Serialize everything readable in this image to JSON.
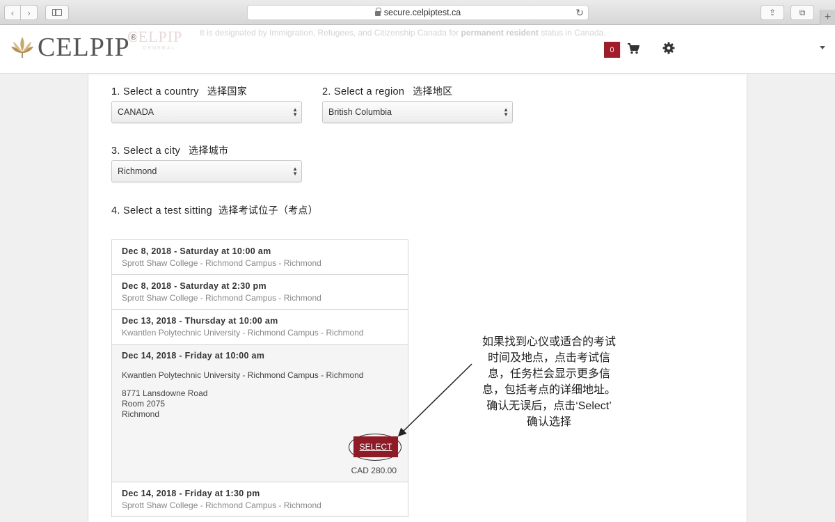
{
  "browser": {
    "url": "secure.celpiptest.ca",
    "back_glyph": "‹",
    "forward_glyph": "›",
    "reload_glyph": "↻",
    "share_glyph": "⇪",
    "tabs_glyph": "⧉",
    "newtab_glyph": "+"
  },
  "header": {
    "logo_text": "CELPIP",
    "logo_reg": "®",
    "ghost_logo": "CELPIP",
    "ghost_sub": "GENERAL",
    "ghost_banner_prefix": "It is designated by Immigration, Refugees, and Citizenship Canada for ",
    "ghost_banner_bold": "permanent resident",
    "ghost_banner_suffix": " status in Canada.",
    "cart_count": "0",
    "accent_color": "#a01c2a"
  },
  "form": {
    "country": {
      "label": "1. Select a country",
      "label_cn": "选择国家",
      "value": "CANADA"
    },
    "region": {
      "label": "2. Select a region",
      "label_cn": "选择地区",
      "value": "British Columbia"
    },
    "city": {
      "label": "3. Select a city",
      "label_cn": "选择城市",
      "value": "Richmond"
    },
    "sitting": {
      "label": "4. Select a test sitting",
      "label_cn": "选择考试位子（考点）"
    }
  },
  "sittings": [
    {
      "date": "Dec 8, 2018 - Saturday at 10:00 am",
      "venue": "Sprott Shaw College - Richmond Campus - Richmond"
    },
    {
      "date": "Dec 8, 2018 - Saturday at 2:30 pm",
      "venue": "Sprott Shaw College - Richmond Campus - Richmond"
    },
    {
      "date": "Dec 13, 2018 - Thursday at 10:00 am",
      "venue": "Kwantlen Polytechnic University - Richmond Campus - Richmond"
    },
    {
      "date": "Dec 14, 2018 - Friday at 10:00 am",
      "venue": "Kwantlen Polytechnic University - Richmond Campus - Richmond",
      "address_line1": "8771 Lansdowne Road",
      "address_line2": "Room 2075",
      "address_line3": "Richmond",
      "select_label": "SELECT",
      "price": "CAD 280.00"
    },
    {
      "date": "Dec 14, 2018 - Friday at 1:30 pm",
      "venue": "Sprott Shaw College - Richmond Campus - Richmond"
    }
  ],
  "annotation": {
    "line1": "如果找到心仪或适合的考试",
    "line2": "时间及地点，点击考试信",
    "line3": "息，任务栏会显示更多信",
    "line4": "息，包括考点的详细地址。",
    "line5": "确认无误后，点击‘Select’",
    "line6": "确认选择"
  }
}
